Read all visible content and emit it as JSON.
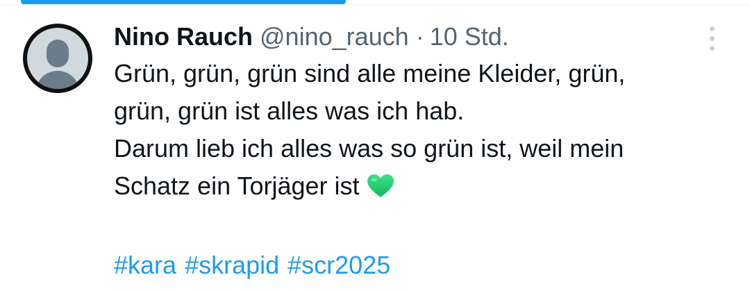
{
  "post": {
    "author": {
      "display_name": "Nino Rauch",
      "handle": "@nino_rauch",
      "separator": "·",
      "time": "10 Std."
    },
    "text_lines": [
      "Grün, grün, grün sind alle meine Kleider, grün,",
      "grün, grün ist alles was ich hab.",
      "Darum lieb ich alles was so grün ist, weil mein",
      "Schatz ein Torjäger ist"
    ],
    "emoji": "green-heart-icon",
    "hashtags": [
      "#kara",
      "#skrapid",
      "#scr2025"
    ]
  },
  "colors": {
    "accent": "#1d9bf0",
    "text": "#0f1419",
    "secondary": "#536471",
    "heart": "#1fc86a"
  }
}
